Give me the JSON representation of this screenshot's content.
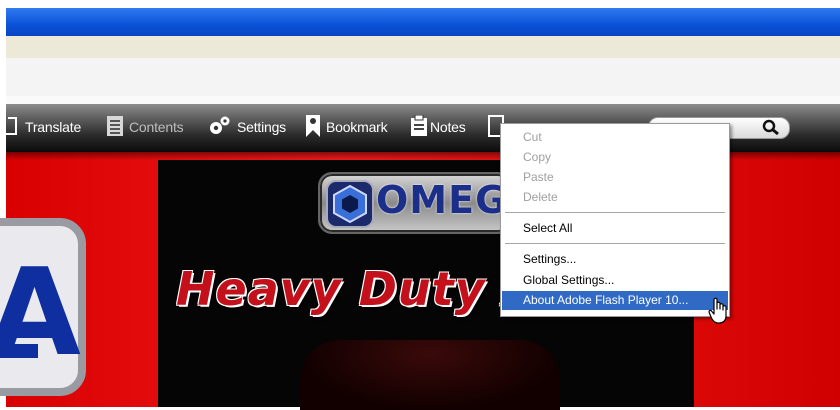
{
  "toolbar": {
    "translate": "Translate",
    "contents": "Contents",
    "settings": "Settings",
    "bookmark": "Bookmark",
    "notes": "Notes"
  },
  "page": {
    "logo_text": "OMEG",
    "headline": "Heavy Duty A",
    "left_badge_letter": "A"
  },
  "context_menu": {
    "items": [
      {
        "label": "Cut",
        "enabled": false
      },
      {
        "label": "Copy",
        "enabled": false
      },
      {
        "label": "Paste",
        "enabled": false
      },
      {
        "label": "Delete",
        "enabled": false
      },
      {
        "label": "Select All",
        "enabled": true
      },
      {
        "label": "Settings...",
        "enabled": true
      },
      {
        "label": "Global Settings...",
        "enabled": true
      },
      {
        "label": "About Adobe Flash Player 10...",
        "enabled": true,
        "highlighted": true
      }
    ]
  },
  "colors": {
    "menu_highlight": "#316ac5",
    "page_red": "#e80c0c",
    "title_bar_blue": "#0a52d8"
  },
  "icons": [
    "translate-icon",
    "contents-icon",
    "settings-icon",
    "bookmark-icon",
    "notes-icon",
    "page-icon",
    "search-icon",
    "hand-cursor-icon"
  ]
}
